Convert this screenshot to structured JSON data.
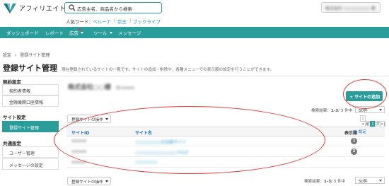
{
  "header": {
    "logo_text": "アフィリエイト",
    "search_placeholder": "広告主名、商品名から検索",
    "popular_label": "人気ワード：",
    "popular_words": [
      "ベルーナ",
      "京王",
      "ブックライブ"
    ],
    "user_name": "株式会社 ○○○○○○○ 様"
  },
  "nav": {
    "items": [
      "ダッシュボード",
      "レポート",
      "広告",
      "ツール",
      "メッセージ"
    ]
  },
  "breadcrumb": {
    "home": "設定",
    "sep": "›",
    "current": "登録サイト管理"
  },
  "page": {
    "title": "登録サイト管理",
    "description": "現在登録されているサイトの一覧です。サイトの追加・削除や、各種メニューでの表示順の設定を行うことができます。"
  },
  "sidebar": {
    "sections": [
      {
        "heading": "契約設定",
        "items": [
          "契約者情報",
          "金融機関口座情報"
        ]
      },
      {
        "heading": "サイト設定",
        "items": [
          "登録サイト管理"
        ]
      },
      {
        "heading": "共通設定",
        "items": [
          "ユーザー管理",
          "メッセージの設定"
        ]
      }
    ],
    "active": "登録サイト管理"
  },
  "main": {
    "owner_name": "株式会社○○様",
    "owner_id": "ID:xxxxx",
    "add_site_label": "+ サイトの追加",
    "result_label": "検索結果：",
    "result_range": "1-3",
    "result_total": "/ 3 件中",
    "per_page": "50件",
    "site_ops_label": "登録サイトの操作",
    "pager": {
      "first": "|<",
      "prev": "前",
      "current": "1",
      "next": "次",
      "last": ">|"
    },
    "table": {
      "columns": [
        "サイトID",
        "サイト名",
        "表示順"
      ],
      "settings_label": "設定",
      "rows": [
        {
          "id": "xxxxxx",
          "name": "○○○○○○○の比較サイト",
          "order": "1"
        },
        {
          "id": "xxxxxx",
          "name": "○○○○○○○○○○○ブログ",
          "order": "2"
        },
        {
          "id": "xxxxxx",
          "name": "○○○○○○",
          "order": ""
        }
      ]
    }
  },
  "colors": {
    "brand": "#2a9d9a",
    "link": "#1a8fbf",
    "annotation": "#e23a3a"
  }
}
